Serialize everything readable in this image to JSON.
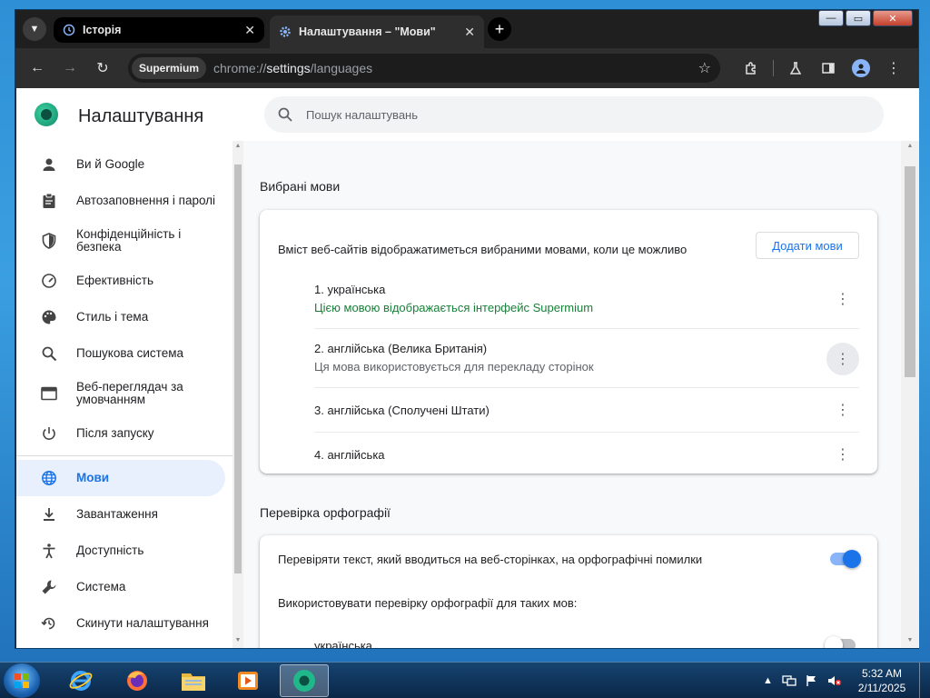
{
  "browser": {
    "tabs": [
      {
        "label": "Історія",
        "icon": "history-icon"
      },
      {
        "label": "Налаштування – \"Мови\"",
        "icon": "gear-icon"
      }
    ],
    "omnibox": {
      "site_chip": "Supermium",
      "url_prefix": "chrome://",
      "url_host": "settings",
      "url_path": "/languages"
    }
  },
  "header": {
    "title": "Налаштування",
    "search_placeholder": "Пошук налаштувань"
  },
  "sidebar": {
    "items": [
      {
        "label": "Ви й Google",
        "icon": "person-icon"
      },
      {
        "label": "Автозаповнення і паролі",
        "icon": "clipboard-icon"
      },
      {
        "label": "Конфіденційність і безпека",
        "icon": "shield-icon"
      },
      {
        "label": "Ефективність",
        "icon": "speedometer-icon"
      },
      {
        "label": "Стиль і тема",
        "icon": "palette-icon"
      },
      {
        "label": "Пошукова система",
        "icon": "search-icon"
      },
      {
        "label": "Веб-переглядач за умовчанням",
        "icon": "browser-window-icon"
      },
      {
        "label": "Після запуску",
        "icon": "power-icon"
      },
      {
        "label": "Мови",
        "icon": "globe-icon",
        "active": true
      },
      {
        "label": "Завантаження",
        "icon": "download-icon"
      },
      {
        "label": "Доступність",
        "icon": "accessibility-icon"
      },
      {
        "label": "Система",
        "icon": "wrench-icon"
      },
      {
        "label": "Скинути налаштування",
        "icon": "reset-history-icon"
      }
    ]
  },
  "languages": {
    "section_title": "Вибрані мови",
    "description": "Вміст веб-сайтів відображатиметься вибраними мовами, коли це можливо",
    "add_button": "Додати мови",
    "items": [
      {
        "name": "1. українська",
        "subtitle": "Цією мовою відображається інтерфейс Supermium"
      },
      {
        "name": "2. англійська (Велика Британія)",
        "subtitle": "Ця мова використовується для перекладу сторінок"
      },
      {
        "name": "3. англійська (Сполучені Штати)",
        "subtitle": ""
      },
      {
        "name": "4. англійська",
        "subtitle": ""
      }
    ]
  },
  "spellcheck": {
    "section_title": "Перевірка орфографії",
    "check_label": "Перевіряти текст, який вводиться на веб-сторінках, на орфографічні помилки",
    "check_enabled": true,
    "languages_label": "Використовувати перевірку орфографії для таких мов:",
    "languages": [
      {
        "name": "українська",
        "enabled": false
      }
    ]
  },
  "taskbar": {
    "apps": [
      "internet-explorer-icon",
      "firefox-icon",
      "file-explorer-icon",
      "media-player-icon",
      "supermium-icon"
    ],
    "time": "5:32 AM",
    "date": "2/11/2025"
  },
  "colors": {
    "accent": "#1a73e8",
    "active_nav_bg": "#e8f0fe",
    "green_text": "#188038"
  }
}
